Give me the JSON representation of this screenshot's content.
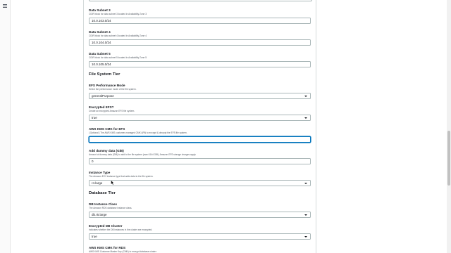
{
  "fields": {
    "subnet3": {
      "label": "Data Subnet 3",
      "desc": "CIDR block for data subnet 3 located in Availability Zone 3",
      "value": "10.0.103.0/24"
    },
    "subnet4": {
      "label": "Data Subnet 4",
      "desc": "CIDR block for data subnet 4 located in Availability Zone 4",
      "value": "10.0.104.0/24"
    },
    "subnet5": {
      "label": "Data Subnet 5",
      "desc": "CIDR block for data subnet 5 located in Availability Zone 5",
      "value": "10.0.105.0/24"
    },
    "efs_performance_mode": {
      "label": "EFS Performance Mode",
      "desc": "Select the performance mode of the file system.",
      "value": "generalPurpose"
    },
    "encrypted_efs": {
      "label": "Encrypted EFS?",
      "desc": "Create an encrypted Amazon EFS file system.",
      "value": "true"
    },
    "kms_cmk_efs": {
      "label": "AWS KMS CMK for EFS",
      "desc": "[ Optional ] The AWS KMS customer-managed CMK ARN to encrypt & decrypt the EFS file system.",
      "value": ""
    },
    "dummy_data": {
      "label": "Add dummy data (GiB)",
      "desc": "Amount of dummy data (GiB) to add to the file system (max 6144 GiB). Amazon EFS storage charges apply.",
      "value": "0"
    },
    "instance_type": {
      "label": "Instance Type",
      "desc": "The Amazon EC2 instance type that adds data to the file system.",
      "value": "r4.large"
    },
    "db_instance_class": {
      "label": "DB Instance Class",
      "desc": "The Amazon RDS database instance class.",
      "value": "db.r5.large"
    },
    "encrypted_db_cluster": {
      "label": "Encrypted DB Cluster",
      "desc": "Indicates whether the DB instances in the cluster are encrypted.",
      "value": "true"
    },
    "kms_cmk_rds": {
      "label": "AWS KMS CMK for RDS",
      "desc": "AWS KMS Customer Master Key (CMK) to encrypt database cluster"
    }
  },
  "sections": {
    "file_system_tier": "File System Tier",
    "database_tier": "Database Tier"
  },
  "icons": {
    "menu": "hamburger-icon",
    "dropdown": "caret-down-icon",
    "pointer": "mouse-pointer-icon"
  },
  "colors": {
    "focus_border": "#0073bb",
    "field_border": "#aab7b8",
    "label_text": "#16191f",
    "description_text": "#545b64"
  }
}
